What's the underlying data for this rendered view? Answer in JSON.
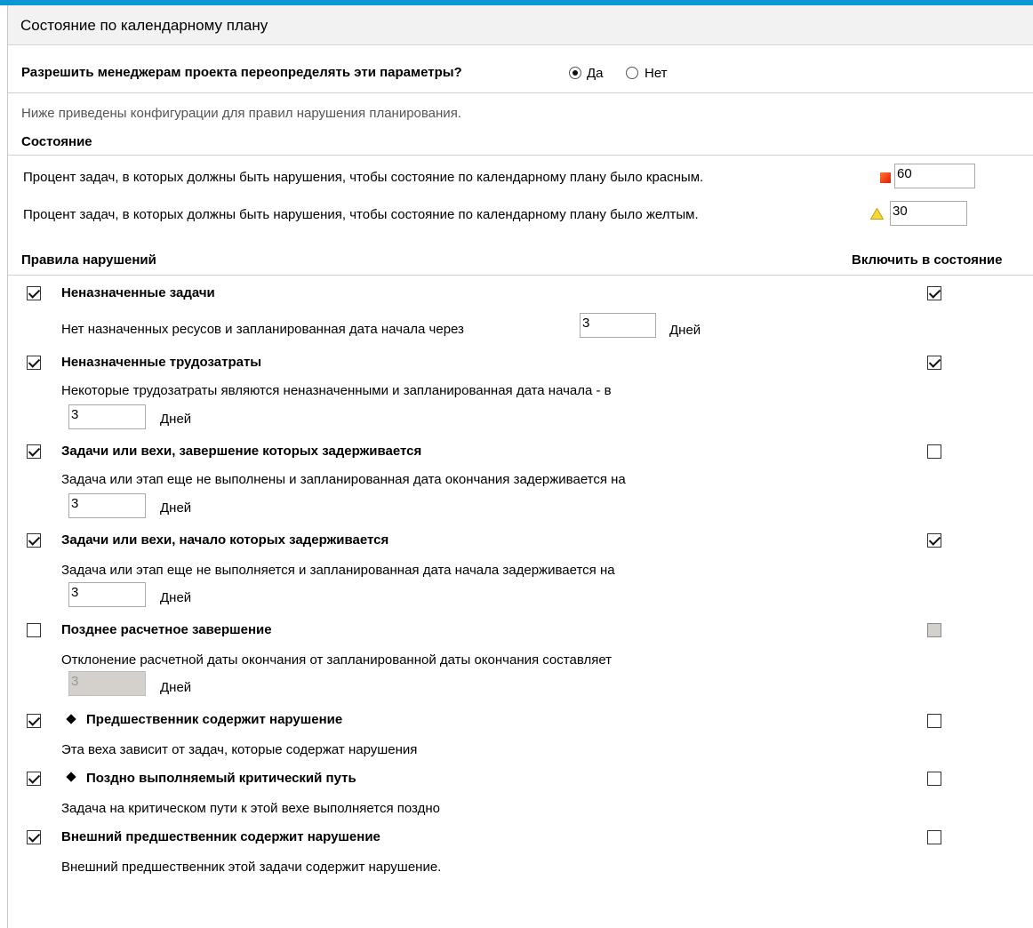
{
  "header": {
    "title": "Состояние по календарному плану"
  },
  "override": {
    "question": "Разрешить менеджерам проекта переопределять эти параметры?",
    "yes_label": "Да",
    "no_label": "Нет",
    "selected": "yes"
  },
  "description": "Ниже приведены конфигурации для правил нарушения планирования.",
  "state": {
    "heading": "Состояние",
    "red": {
      "label": "Процент задач, в которых должны быть нарушения, чтобы состояние по календарному плану было красным.",
      "value": "60",
      "icon": "red-square-icon"
    },
    "yellow": {
      "label": "Процент задач, в которых должны быть нарушения, чтобы состояние по календарному плану было желтым.",
      "value": "30",
      "icon": "yellow-triangle-icon"
    }
  },
  "rules": {
    "heading": "Правила нарушений",
    "include_heading": "Включить в состояние",
    "days_label": "Дней",
    "items": [
      {
        "title": "Неназначенные задачи",
        "enabled": true,
        "include": true,
        "detail": "Нет назначенных ресусов и запланированная дата начала через",
        "value": "3"
      },
      {
        "title": "Неназначенные трудозатраты",
        "enabled": true,
        "include": true,
        "detail": "Некоторые трудозатраты являются неназначенными и запланированная дата начала - в",
        "value": "3"
      },
      {
        "title": "Задачи или вехи, завершение которых задерживается",
        "enabled": true,
        "include": false,
        "detail": "Задача или этап еще не выполнены и запланированная дата окончания задерживается на",
        "value": "3"
      },
      {
        "title": "Задачи или вехи, начало которых задерживается",
        "enabled": true,
        "include": true,
        "detail": "Задача или этап еще не выполняется и запланированная дата начала задерживается на",
        "value": "3"
      },
      {
        "title": "Позднее расчетное завершение",
        "enabled": false,
        "include": false,
        "detail": "Отклонение расчетной даты окончания от запланированной даты окончания составляет",
        "value": "3"
      },
      {
        "title": "Предшественник содержит нарушение",
        "enabled": true,
        "include": false,
        "detail": "Эта веха зависит от задач, которые содержат нарушения",
        "icon": "milestone-diamond-icon"
      },
      {
        "title": "Поздно выполняемый критический путь",
        "enabled": true,
        "include": false,
        "detail": "Задача на критическом пути к этой вехе выполняется поздно",
        "icon": "milestone-diamond-icon"
      },
      {
        "title": "Внешний предшественник содержит нарушение",
        "enabled": true,
        "include": false,
        "detail": "Внешний предшественник этой задачи содержит нарушение."
      }
    ]
  }
}
